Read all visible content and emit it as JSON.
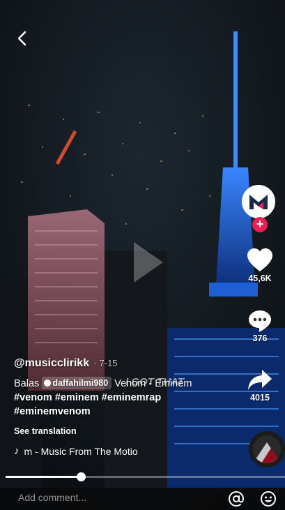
{
  "video": {
    "overlay_text": "I GOT THAT"
  },
  "nav": {
    "back_icon": "chevron-left-icon"
  },
  "creator": {
    "username": "@musicclirikk",
    "date": "· 7-15",
    "avatar_letter": "M"
  },
  "actions": {
    "likes": "45,6K",
    "comments": "376",
    "shares": "4015"
  },
  "caption": {
    "reply_prefix": "Balas",
    "mention": "daffahilmi980",
    "text": "Venom - Eminem",
    "hashtags": [
      "#venom",
      "#eminem",
      "#eminemrap",
      "#eminemvenom"
    ],
    "see_translation": "See translation"
  },
  "music": {
    "title": "m - Music From The Motio"
  },
  "progress": {
    "fraction": 0.27
  },
  "comment_bar": {
    "placeholder": "Add comment..."
  },
  "colors": {
    "follow_badge": "#ee1d52",
    "building_blue": "#2f7bff",
    "building_pink": "#c7808a"
  }
}
